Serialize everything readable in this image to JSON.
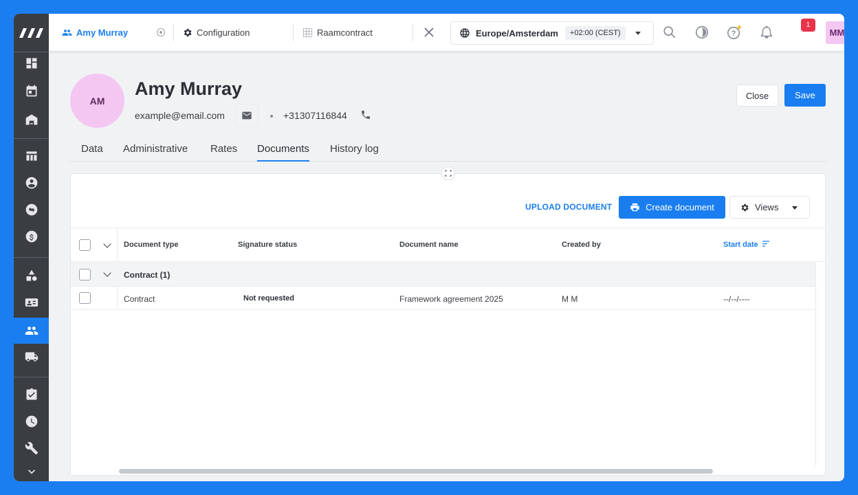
{
  "tabs": [
    {
      "label": "Amy Murray",
      "icon": "people-icon",
      "active": true
    },
    {
      "label": "Configuration",
      "icon": "gear-icon"
    },
    {
      "label": "Raamcontract",
      "icon": "grid-icon"
    }
  ],
  "timezone": {
    "name": "Europe/Amsterdam",
    "offset": "+02:00 (CEST)"
  },
  "notifications": {
    "count": "1"
  },
  "user": {
    "initials": "MM",
    "name": "M M"
  },
  "profile": {
    "initials": "AM",
    "name": "Amy Murray",
    "email": "example@email.com",
    "phone": "+31307116844"
  },
  "actions": {
    "close": "Close",
    "save": "Save"
  },
  "subtabs": [
    "Data",
    "Administrative",
    "Rates",
    "Documents",
    "History log"
  ],
  "active_subtab": "Documents",
  "toolbar": {
    "upload": "UPLOAD DOCUMENT",
    "create": "Create document",
    "views": "Views"
  },
  "table": {
    "columns": [
      "Document type",
      "Signature status",
      "Document name",
      "Created by",
      "Start date"
    ],
    "group": "Contract (1)",
    "rows": [
      {
        "type": "Contract",
        "signature": "Not requested",
        "name": "Framework agreement 2025",
        "created_by": "M M",
        "start_date": "--/--/----"
      }
    ]
  },
  "colors": {
    "accent": "#1a7ef0",
    "sidebar": "#3a3d42",
    "avatar": "#f4c7f3",
    "badge": "#e8334a"
  }
}
